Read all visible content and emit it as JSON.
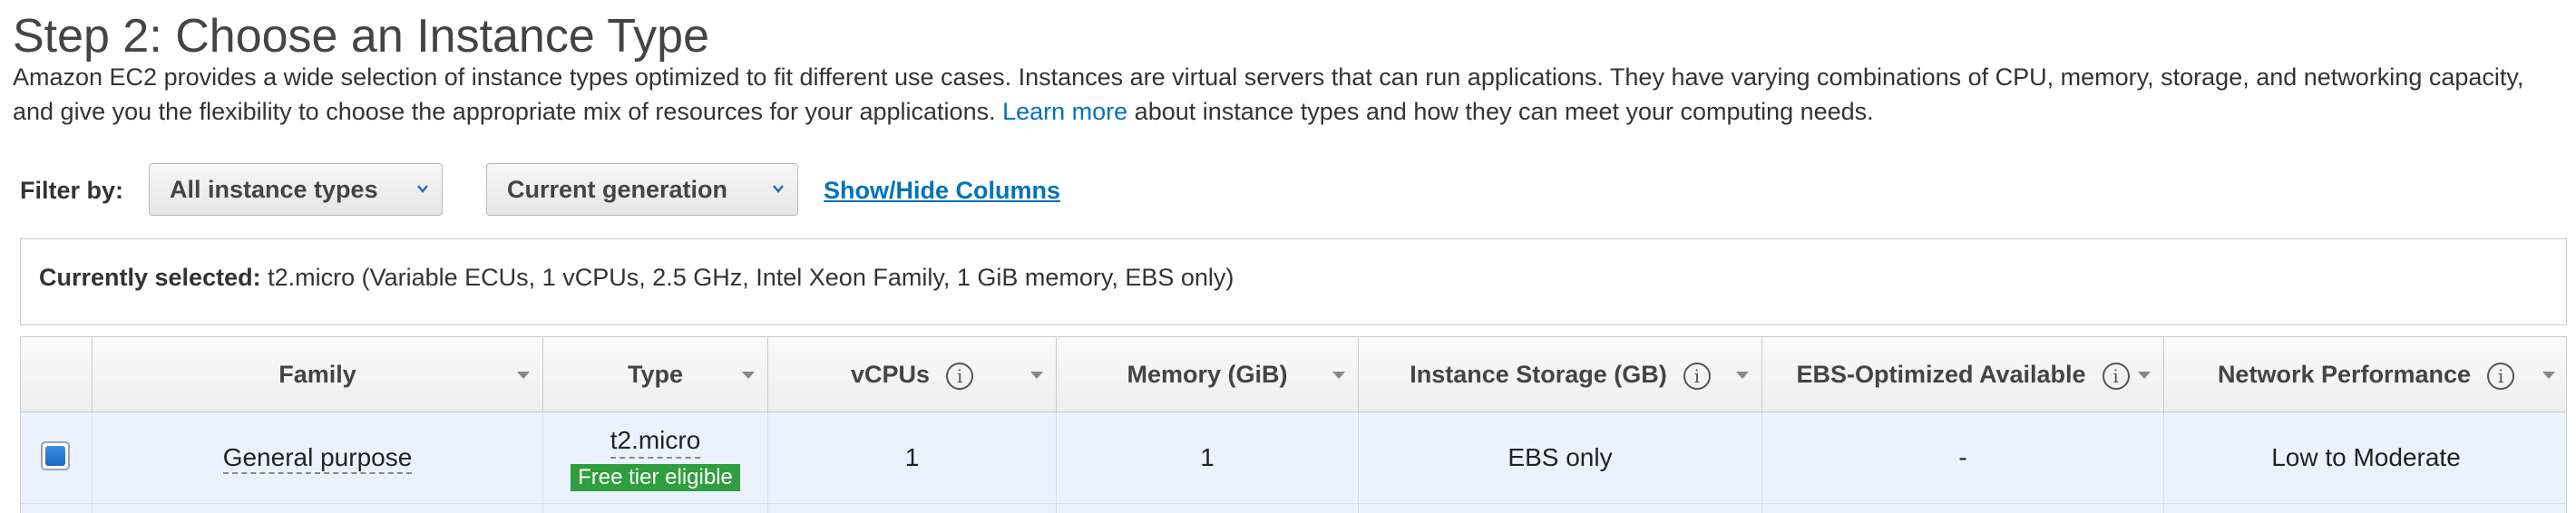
{
  "page": {
    "title": "Step 2: Choose an Instance Type",
    "description_before": "Amazon EC2 provides a wide selection of instance types optimized to fit different use cases. Instances are virtual servers that can run applications. They have varying combinations of CPU, memory, storage, and networking capacity, and give you the flexibility to choose the appropriate mix of resources for your applications. ",
    "learn_more": "Learn more",
    "description_after": " about instance types and how they can meet your computing needs."
  },
  "filter": {
    "label": "Filter by:",
    "instance_types": "All instance types",
    "generation": "Current generation",
    "show_hide": "Show/Hide Columns"
  },
  "selection": {
    "label": "Currently selected:",
    "value": " t2.micro (Variable ECUs, 1 vCPUs, 2.5 GHz, Intel Xeon Family, 1 GiB memory, EBS only)"
  },
  "table": {
    "columns": {
      "family": "Family",
      "type": "Type",
      "vcpus": "vCPUs",
      "memory": "Memory (GiB)",
      "storage": "Instance Storage (GB)",
      "ebs": "EBS-Optimized Available",
      "network": "Network Performance"
    },
    "info_glyph": "i",
    "rows": [
      {
        "family": "General purpose",
        "type": "t2.micro",
        "badge": "Free tier eligible",
        "vcpus": "1",
        "memory": "1",
        "storage": "EBS only",
        "ebs": "-",
        "network": "Low to Moderate",
        "selected": true
      }
    ]
  },
  "colors": {
    "link": "#0073bb",
    "badge": "#2e9e3f",
    "row_selected": "#eaf3fd"
  },
  "icons": {
    "dropdown": "chevron-down-icon",
    "sort": "sort-down-icon",
    "info": "info-icon"
  }
}
